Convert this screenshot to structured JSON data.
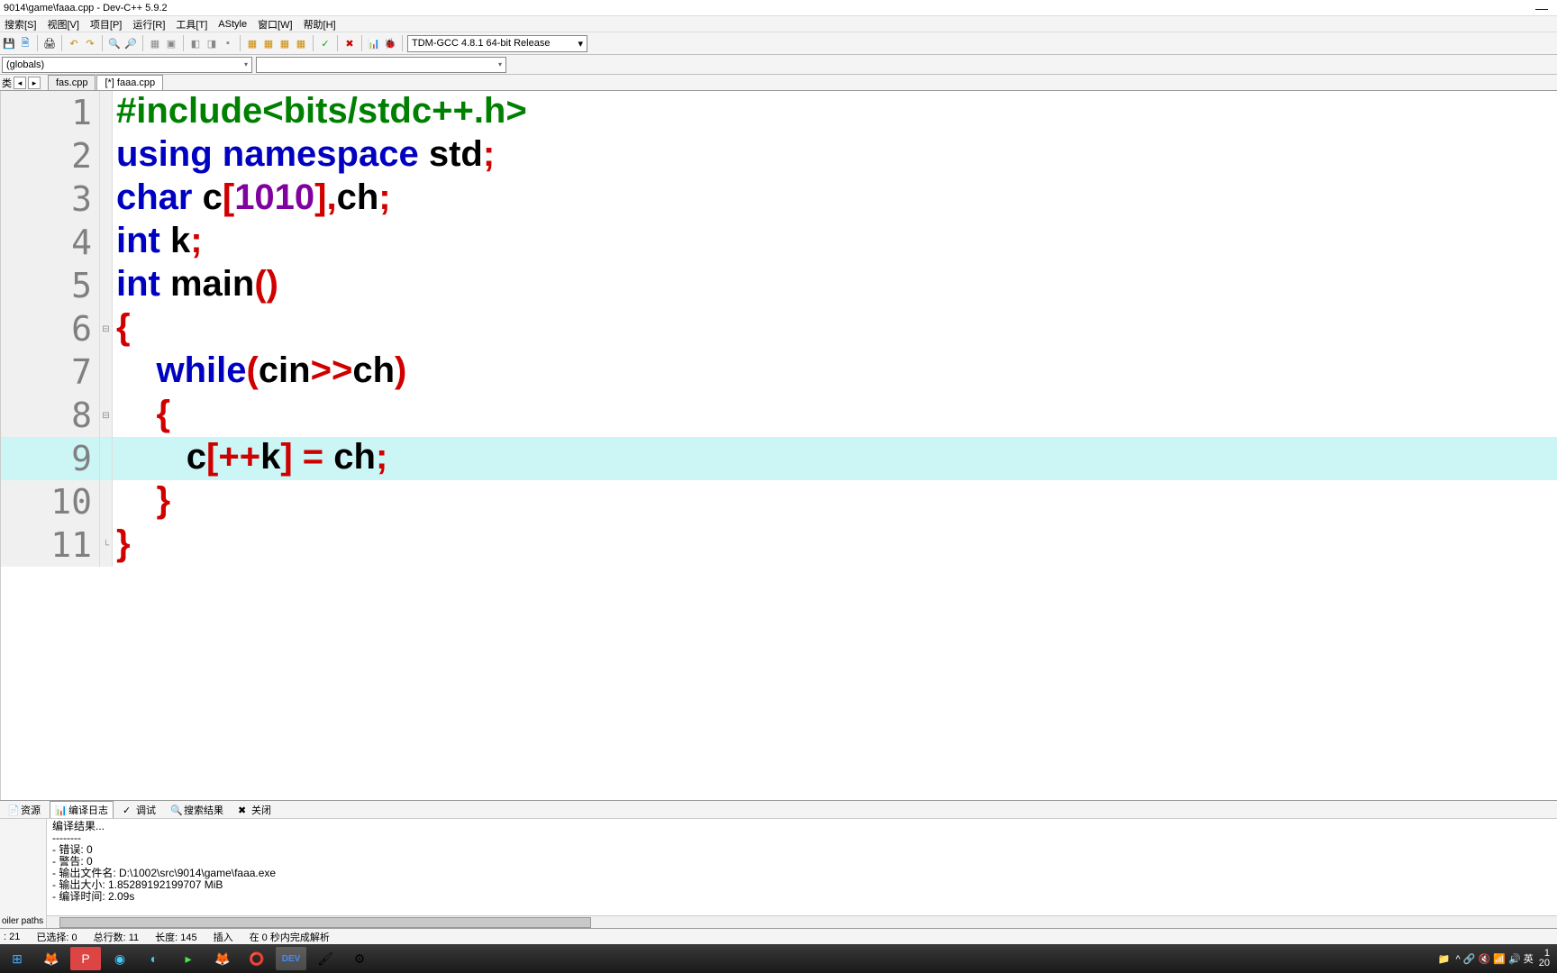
{
  "title": "9014\\game\\faaa.cpp - Dev-C++ 5.9.2",
  "menu": [
    "搜索[S]",
    "视图[V]",
    "项目[P]",
    "运行[R]",
    "工具[T]",
    "AStyle",
    "窗口[W]",
    "帮助[H]"
  ],
  "compiler_combo": "TDM-GCC 4.8.1 64-bit Release",
  "globals_combo": "(globals)",
  "side_tab_label": "类",
  "tabs": [
    {
      "label": "fas.cpp",
      "active": false
    },
    {
      "label": "[*] faaa.cpp",
      "active": true
    }
  ],
  "code": [
    {
      "n": "1",
      "fold": "",
      "tokens": [
        {
          "c": "kw-green",
          "t": "#include<bits/stdc++.h>"
        }
      ]
    },
    {
      "n": "2",
      "fold": "",
      "tokens": [
        {
          "c": "kw-blue",
          "t": "using "
        },
        {
          "c": "kw-blue",
          "t": "namespace"
        },
        {
          "c": "kw-black",
          "t": " std"
        },
        {
          "c": "kw-red",
          "t": ";"
        }
      ]
    },
    {
      "n": "3",
      "fold": "",
      "tokens": [
        {
          "c": "kw-blue",
          "t": "char"
        },
        {
          "c": "kw-black",
          "t": " c"
        },
        {
          "c": "kw-red",
          "t": "["
        },
        {
          "c": "kw-purple",
          "t": "1010"
        },
        {
          "c": "kw-red",
          "t": "],"
        },
        {
          "c": "kw-black",
          "t": "ch"
        },
        {
          "c": "kw-red",
          "t": ";"
        }
      ]
    },
    {
      "n": "4",
      "fold": "",
      "tokens": [
        {
          "c": "kw-blue",
          "t": "int"
        },
        {
          "c": "kw-black",
          "t": " k"
        },
        {
          "c": "kw-red",
          "t": ";"
        }
      ]
    },
    {
      "n": "5",
      "fold": "",
      "tokens": [
        {
          "c": "kw-blue",
          "t": "int"
        },
        {
          "c": "kw-black",
          "t": " main"
        },
        {
          "c": "kw-red",
          "t": "()"
        }
      ]
    },
    {
      "n": "6",
      "fold": "⊟",
      "tokens": [
        {
          "c": "kw-red",
          "t": "{"
        }
      ]
    },
    {
      "n": "7",
      "fold": "",
      "tokens": [
        {
          "c": "kw-black",
          "t": "    "
        },
        {
          "c": "kw-blue",
          "t": "while"
        },
        {
          "c": "kw-red",
          "t": "("
        },
        {
          "c": "kw-black",
          "t": "cin"
        },
        {
          "c": "kw-red",
          "t": ">>"
        },
        {
          "c": "kw-black",
          "t": "ch"
        },
        {
          "c": "kw-red",
          "t": ")"
        }
      ]
    },
    {
      "n": "8",
      "fold": "⊟",
      "tokens": [
        {
          "c": "kw-black",
          "t": "    "
        },
        {
          "c": "kw-red",
          "t": "{"
        }
      ]
    },
    {
      "n": "9",
      "fold": "",
      "hl": true,
      "tokens": [
        {
          "c": "kw-black",
          "t": "       c"
        },
        {
          "c": "kw-red",
          "t": "[++"
        },
        {
          "c": "kw-black",
          "t": "k"
        },
        {
          "c": "kw-red",
          "t": "]"
        },
        {
          "c": "kw-black",
          "t": " "
        },
        {
          "c": "kw-red",
          "t": "="
        },
        {
          "c": "kw-black",
          "t": " ch"
        },
        {
          "c": "kw-red",
          "t": ";"
        }
      ]
    },
    {
      "n": "10",
      "fold": "",
      "tokens": [
        {
          "c": "kw-black",
          "t": "    "
        },
        {
          "c": "kw-red",
          "t": "}"
        }
      ]
    },
    {
      "n": "11",
      "fold": "└",
      "tokens": [
        {
          "c": "kw-red",
          "t": "}"
        }
      ]
    }
  ],
  "bottom_tabs": [
    {
      "label": "资源",
      "icon": "📄"
    },
    {
      "label": "编译日志",
      "icon": "📊",
      "active": true
    },
    {
      "label": "调试",
      "icon": "✓"
    },
    {
      "label": "搜索结果",
      "icon": "🔍"
    },
    {
      "label": "关闭",
      "icon": "✖"
    }
  ],
  "output_side": "oiler paths",
  "output": "编译结果...\n--------\n- 错误: 0\n- 警告: 0\n- 输出文件名: D:\\1002\\src\\9014\\game\\faaa.exe\n- 输出大小: 1.85289192199707 MiB\n- 编译时间: 2.09s",
  "status": {
    "col": ": 21",
    "sel": "已选择:  0",
    "lines": "总行数:  11",
    "len": "长度:  145",
    "mode": "插入",
    "parse": "在 0 秒内完成解析"
  },
  "tray_text": "^ 🔗 🔇 📶 🔊 英",
  "tray_time": "1",
  "tray_date": "20"
}
